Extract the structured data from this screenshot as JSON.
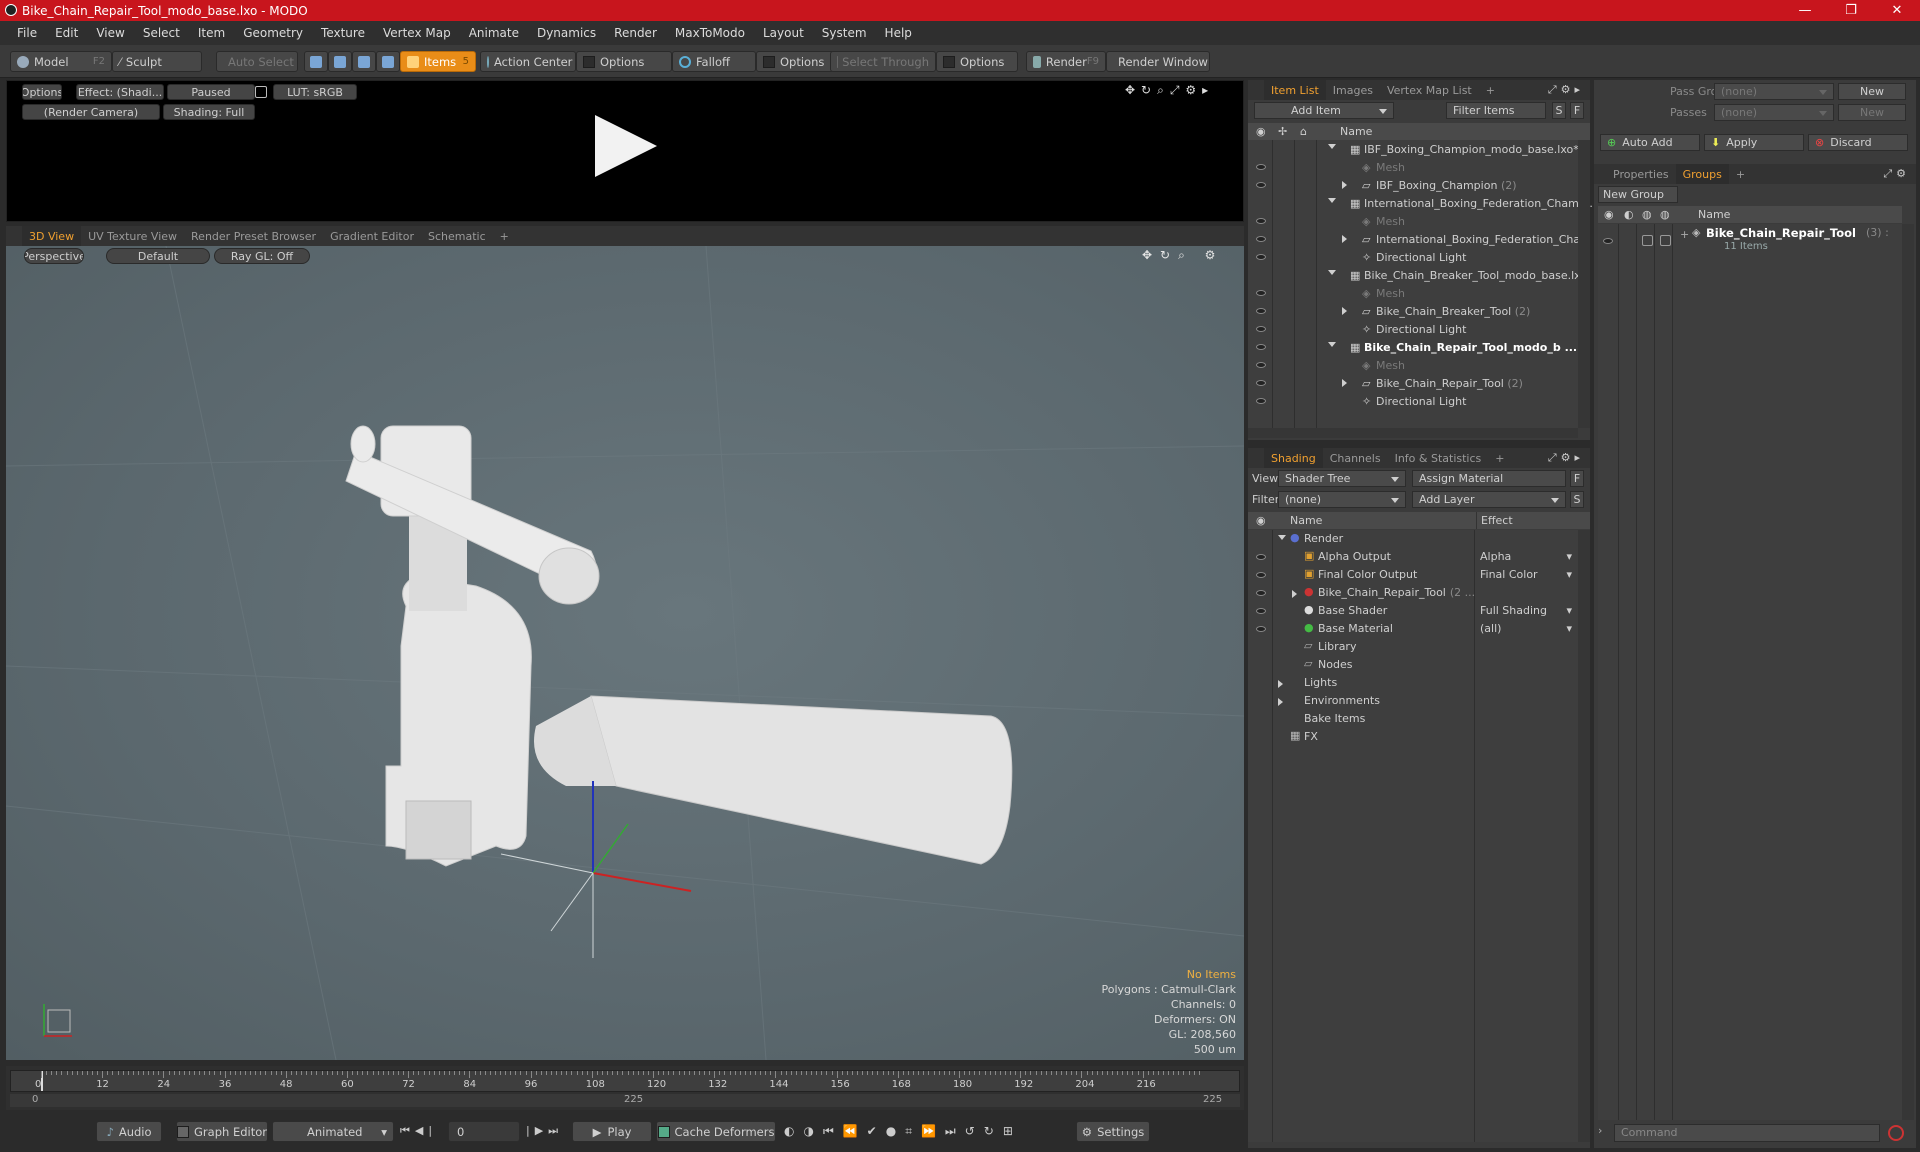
{
  "window": {
    "title": "Bike_Chain_Repair_Tool_modo_base.lxo - MODO",
    "min": "—",
    "max": "❐",
    "close": "✕"
  },
  "menu": [
    "File",
    "Edit",
    "View",
    "Select",
    "Item",
    "Geometry",
    "Texture",
    "Vertex Map",
    "Animate",
    "Dynamics",
    "Render",
    "MaxToModo",
    "Layout",
    "System",
    "Help"
  ],
  "toolbar": {
    "model": "Model",
    "model_key": "F2",
    "sculpt": "Sculpt",
    "auto_select": "Auto Select",
    "items": "Items",
    "items_key": "5",
    "action_center": "Action Center",
    "options1": "Options",
    "falloff": "Falloff",
    "options2": "Options",
    "select_through": "Select Through",
    "options3": "Options",
    "render": "Render",
    "render_key": "F9",
    "render_window": "Render Window"
  },
  "render_preview": {
    "options": "Options",
    "effect": "Effect: (Shadi...",
    "paused": "Paused",
    "lut": "LUT: sRGB",
    "camera": "(Render Camera)",
    "shading": "Shading: Full"
  },
  "viewport": {
    "tabs": [
      "3D View",
      "UV Texture View",
      "Render Preset Browser",
      "Gradient Editor",
      "Schematic",
      "+"
    ],
    "perspective": "Perspective",
    "default": "Default",
    "raygl": "Ray GL: Off",
    "status": {
      "no_items": "No Items",
      "polygons": "Polygons : Catmull-Clark",
      "channels": "Channels: 0",
      "deformers": "Deformers: ON",
      "gl": "GL: 208,560",
      "unit": "500 um"
    }
  },
  "timeline": {
    "ticks": [
      "0",
      "12",
      "24",
      "36",
      "48",
      "60",
      "72",
      "84",
      "96",
      "108",
      "120",
      "132",
      "144",
      "156",
      "168",
      "180",
      "192",
      "204",
      "216"
    ],
    "start": "0",
    "mid": "225",
    "end": "225"
  },
  "bottombar": {
    "audio": "Audio",
    "graph_editor": "Graph Editor",
    "animated": "Animated",
    "frame": "0",
    "play": "Play",
    "cache_deformers": "Cache Deformers",
    "settings": "Settings"
  },
  "item_list": {
    "tabs": [
      "Item List",
      "Images",
      "Vertex Map List",
      "+"
    ],
    "add_item": "Add Item",
    "filter_items": "Filter Items",
    "s": "S",
    "f": "F",
    "col_name": "Name",
    "rows": [
      {
        "label": "IBF_Boxing_Champion_modo_base.lxo*",
        "kind": "scene",
        "indent": 0
      },
      {
        "label": "Mesh",
        "kind": "mesh",
        "indent": 1
      },
      {
        "label": "IBF_Boxing_Champion",
        "count": "(2)",
        "kind": "group",
        "indent": 1
      },
      {
        "label": "International_Boxing_Federation_Cham ...",
        "kind": "scene",
        "indent": 0
      },
      {
        "label": "Mesh",
        "kind": "mesh",
        "indent": 1
      },
      {
        "label": "International_Boxing_Federation_Cha...",
        "kind": "group",
        "indent": 1
      },
      {
        "label": "Directional Light",
        "kind": "light",
        "indent": 1
      },
      {
        "label": "Bike_Chain_Breaker_Tool_modo_base.lxo",
        "kind": "scene",
        "indent": 0
      },
      {
        "label": "Mesh",
        "kind": "mesh",
        "indent": 1
      },
      {
        "label": "Bike_Chain_Breaker_Tool",
        "count": "(2)",
        "kind": "group",
        "indent": 1
      },
      {
        "label": "Directional Light",
        "kind": "light",
        "indent": 1
      },
      {
        "label": "Bike_Chain_Repair_Tool_modo_b ...",
        "kind": "scene-bold",
        "indent": 0
      },
      {
        "label": "Mesh",
        "kind": "mesh",
        "indent": 1
      },
      {
        "label": "Bike_Chain_Repair_Tool",
        "count": "(2)",
        "kind": "group",
        "indent": 1
      },
      {
        "label": "Directional Light",
        "kind": "light",
        "indent": 1
      }
    ]
  },
  "shading": {
    "tabs": [
      "Shading",
      "Channels",
      "Info & Statistics",
      "+"
    ],
    "view_label": "View",
    "view_value": "Shader Tree",
    "assign_material": "Assign Material",
    "filter_label": "Filter",
    "filter_value": "(none)",
    "add_layer": "Add Layer",
    "f": "F",
    "s": "S",
    "col_name": "Name",
    "col_effect": "Effect",
    "rows": [
      {
        "label": "Render",
        "effect": "",
        "icon": "render"
      },
      {
        "label": "Alpha Output",
        "effect": "Alpha",
        "icon": "output"
      },
      {
        "label": "Final Color Output",
        "effect": "Final Color",
        "icon": "output"
      },
      {
        "label": "Bike_Chain_Repair_Tool",
        "count": "(2 ...",
        "effect": "",
        "icon": "material-group"
      },
      {
        "label": "Base Shader",
        "effect": "Full Shading",
        "icon": "shader"
      },
      {
        "label": "Base Material",
        "effect": "(all)",
        "icon": "material"
      },
      {
        "label": "Library",
        "effect": "",
        "icon": "folder"
      },
      {
        "label": "Nodes",
        "effect": "",
        "icon": "folder"
      },
      {
        "label": "Lights",
        "effect": "",
        "icon": "none"
      },
      {
        "label": "Environments",
        "effect": "",
        "icon": "none"
      },
      {
        "label": "Bake Items",
        "effect": "",
        "icon": "none"
      },
      {
        "label": "FX",
        "effect": "",
        "icon": "fx"
      }
    ]
  },
  "groups": {
    "pass_groups": "Pass Groups",
    "passes": "Passes",
    "none": "(none)",
    "new": "New",
    "auto_add": "Auto Add",
    "apply": "Apply",
    "discard": "Discard",
    "tabs": [
      "Properties",
      "Groups",
      "+"
    ],
    "new_group": "New Group",
    "col_name": "Name",
    "item": "Bike_Chain_Repair_Tool",
    "item_count": "(3) :",
    "item_sub": "11 Items"
  },
  "command": {
    "placeholder": "Command"
  },
  "colors": {
    "title": "#c8151d",
    "accent": "#e98d18",
    "viewport_bg": "#5d6a70",
    "tab_active": "#f0a030"
  }
}
